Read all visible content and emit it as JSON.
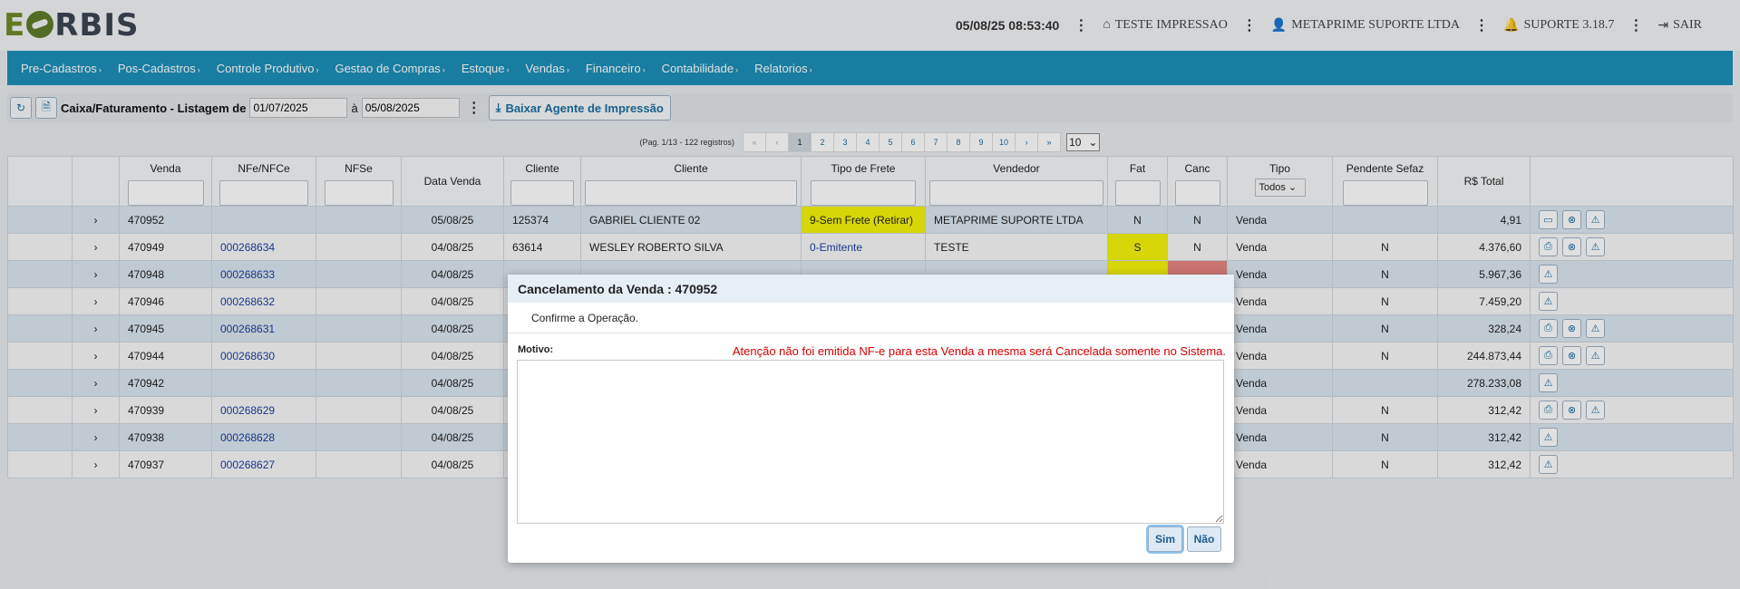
{
  "header": {
    "logo_left": "E",
    "logo_right": "RBIS",
    "datetime": "05/08/25 08:53:40",
    "printer_label": "TESTE IMPRESSAO",
    "company_label": "METAPRIME SUPORTE LTDA",
    "support_label": "SUPORTE 3.18.7",
    "exit_label": "SAIR"
  },
  "menu": [
    "Pre-Cadastros",
    "Pos-Cadastros",
    "Controle Produtivo",
    "Gestao de Compras",
    "Estoque",
    "Vendas",
    "Financeiro",
    "Contabilidade",
    "Relatorios"
  ],
  "toolbar": {
    "title": "Caixa/Faturamento - Listagem de",
    "date_from": "01/07/2025",
    "between": "à",
    "date_to": "05/08/2025",
    "download_label": "Baixar Agente de Impressão"
  },
  "pager": {
    "info": "(Pag. 1/13 - 122 registros)",
    "first": "«",
    "prev": "‹",
    "pages": [
      "1",
      "2",
      "3",
      "4",
      "5",
      "6",
      "7",
      "8",
      "9",
      "10"
    ],
    "next": "›",
    "last": "»",
    "per_page": "10"
  },
  "table": {
    "headers": {
      "venda": "Venda",
      "nfe": "NFe/NFCe",
      "nfse": "NFSe",
      "data": "Data Venda",
      "cliente_cod": "Cliente",
      "cliente": "Cliente",
      "frete": "Tipo de Frete",
      "vendedor": "Vendedor",
      "fat": "Fat",
      "canc": "Canc",
      "tipo": "Tipo",
      "pendente": "Pendente Sefaz",
      "total": "R$ Total"
    },
    "tipo_filter": "Todos",
    "expand_glyph": "›",
    "rows": [
      {
        "venda": "470952",
        "nfe": "",
        "data": "05/08/25",
        "cod": "125374",
        "cliente": "GABRIEL CLIENTE 02",
        "frete": "9-Sem Frete (Retirar)",
        "vendedor": "METAPRIME SUPORTE LTDA",
        "fat": "N",
        "canc": "N",
        "tipo": "Venda",
        "pendente": "",
        "total": "4,91"
      },
      {
        "venda": "470949",
        "nfe": "000268634",
        "data": "04/08/25",
        "cod": "63614",
        "cliente": "WESLEY ROBERTO SILVA",
        "frete": "0-Emitente",
        "vendedor": "TESTE",
        "fat": "S",
        "canc": "N",
        "tipo": "Venda",
        "pendente": "N",
        "total": "4.376,60"
      },
      {
        "venda": "470948",
        "nfe": "000268633",
        "data": "04/08/25",
        "cod": "",
        "cliente": "",
        "frete": "",
        "vendedor": "",
        "fat": "",
        "canc": "",
        "tipo": "Venda",
        "pendente": "N",
        "total": "5.967,36"
      },
      {
        "venda": "470946",
        "nfe": "000268632",
        "data": "04/08/25",
        "cod": "",
        "cliente": "",
        "frete": "",
        "vendedor": "",
        "fat": "",
        "canc": "",
        "tipo": "Venda",
        "pendente": "N",
        "total": "7.459,20"
      },
      {
        "venda": "470945",
        "nfe": "000268631",
        "data": "04/08/25",
        "cod": "",
        "cliente": "",
        "frete": "",
        "vendedor": "",
        "fat": "",
        "canc": "",
        "tipo": "Venda",
        "pendente": "N",
        "total": "328,24"
      },
      {
        "venda": "470944",
        "nfe": "000268630",
        "data": "04/08/25",
        "cod": "",
        "cliente": "",
        "frete": "",
        "vendedor": "",
        "fat": "",
        "canc": "",
        "tipo": "Venda",
        "pendente": "N",
        "total": "244.873,44"
      },
      {
        "venda": "470942",
        "nfe": "",
        "data": "04/08/25",
        "cod": "",
        "cliente": "",
        "frete": "",
        "vendedor": "",
        "fat": "",
        "canc": "",
        "tipo": "Venda",
        "pendente": "",
        "total": "278.233,08"
      },
      {
        "venda": "470939",
        "nfe": "000268629",
        "data": "04/08/25",
        "cod": "",
        "cliente": "",
        "frete": "",
        "vendedor": "",
        "fat": "",
        "canc": "",
        "tipo": "Venda",
        "pendente": "N",
        "total": "312,42"
      },
      {
        "venda": "470938",
        "nfe": "000268628",
        "data": "04/08/25",
        "cod": "",
        "cliente": "",
        "frete": "",
        "vendedor": "",
        "fat": "",
        "canc": "",
        "tipo": "Venda",
        "pendente": "N",
        "total": "312,42"
      },
      {
        "venda": "470937",
        "nfe": "000268627",
        "data": "04/08/25",
        "cod": "",
        "cliente": "",
        "frete": "",
        "vendedor": "",
        "fat": "",
        "canc": "",
        "tipo": "Venda",
        "pendente": "N",
        "total": "312,42"
      }
    ]
  },
  "modal": {
    "title": "Cancelamento da Venda : 470952",
    "confirm": "Confirme a Operação.",
    "motivo_label": "Motivo:",
    "warning": "Atenção não foi emitida NF-e para esta Venda a mesma será Cancelada somente no Sistema.",
    "yes_label": "Sim",
    "no_label": "Não"
  },
  "colors": {
    "menu_bg": "#1d8fb8",
    "row_highlight": "#dbe6ef",
    "frete_highlight": "#f4f40a",
    "fat_highlight": "#f4f40a",
    "canc_highlight": "#e58383",
    "warning": "#d40000"
  }
}
